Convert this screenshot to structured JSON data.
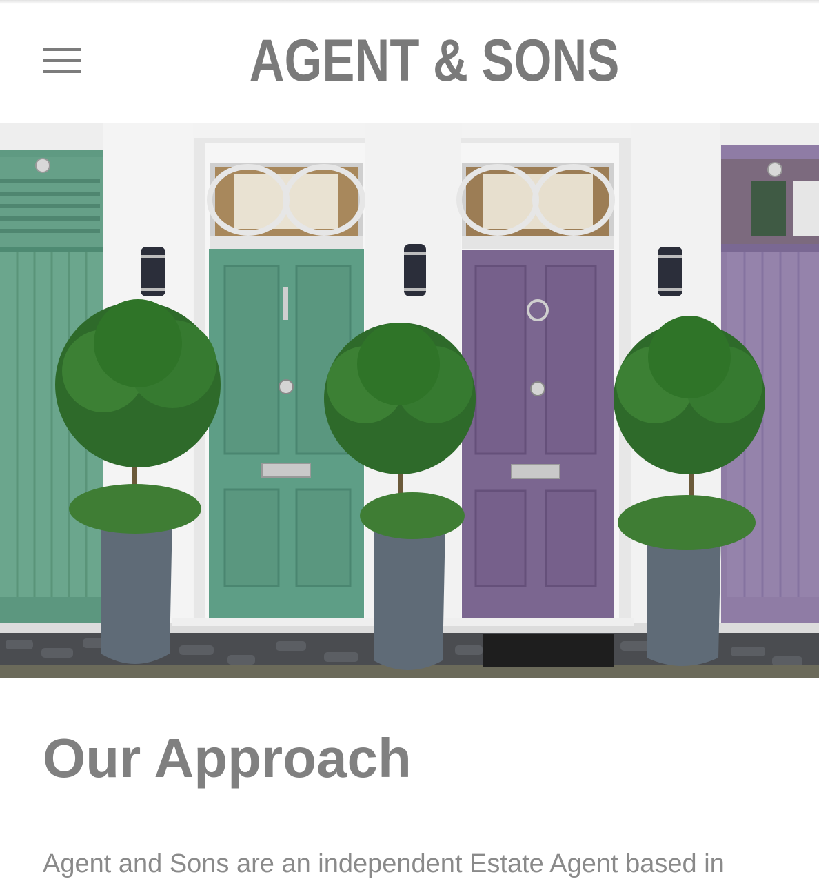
{
  "header": {
    "brand": "AGENT & SONS",
    "menu_icon": "hamburger-menu-icon"
  },
  "hero": {
    "image_description_icon": "hero-image"
  },
  "content": {
    "section_title": "Our Approach",
    "intro_text": "Agent and Sons are an independent Estate Agent based in"
  },
  "colors": {
    "brand_text": "#7a7a7a",
    "heading_text": "#808080",
    "body_text": "#8a8a8a",
    "green_door": "#5e9e86",
    "purple_door": "#7b6690"
  }
}
